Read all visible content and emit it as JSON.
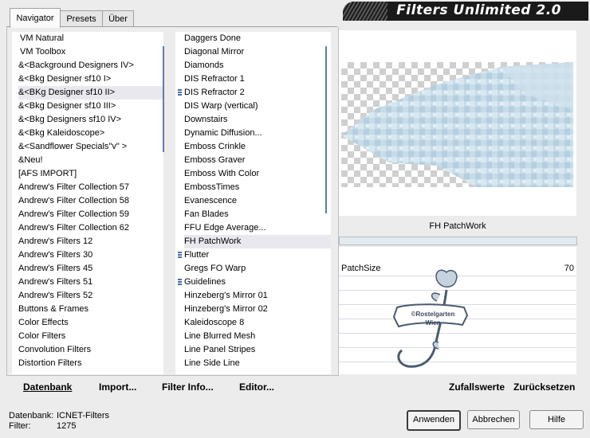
{
  "tabs": [
    "Navigator",
    "Presets",
    "Über"
  ],
  "banner": "Filters Unlimited 2.0",
  "categories": [
    "VM Natural",
    "VM Toolbox",
    "&<Background Designers IV>",
    "&<Bkg Designer sf10 I>",
    "&<BKg Designer sf10 II>",
    "&<Bkg Designer sf10 III>",
    "&<Bkg Designers sf10 IV>",
    "&<Bkg Kaleidoscope>",
    "&<Sandflower Specials\"v\" >",
    "&Neu!",
    "[AFS IMPORT]",
    "Andrew's Filter Collection 57",
    "Andrew's Filter Collection 58",
    "Andrew's Filter Collection 59",
    "Andrew's Filter Collection 62",
    "Andrew's Filters 12",
    "Andrew's Filters 30",
    "Andrew's Filters 45",
    "Andrew's Filters 51",
    "Andrew's Filters 52",
    "Buttons & Frames",
    "Color Effects",
    "Color Filters",
    "Convolution Filters",
    "Distortion Filters"
  ],
  "filters": [
    "Daggers Done",
    "Diagonal Mirror",
    "Diamonds",
    "DIS Refractor 1",
    "DIS Refractor 2",
    "DIS Warp (vertical)",
    "Downstairs",
    "Dynamic Diffusion...",
    "Emboss Crinkle",
    "Emboss Graver",
    "Emboss With Color",
    "EmbossTimes",
    "Evanescence",
    "Fan Blades",
    "FFU Edge Average...",
    "FH PatchWork",
    "Flutter",
    "Gregs FO Warp",
    "Guidelines",
    "Hinzeberg's Mirror 01",
    "Hinzeberg's Mirror 02",
    "Kaleidoscope 8",
    "Line Blurred Mesh",
    "Line Panel Stripes",
    "Line Side Line"
  ],
  "selected_category": "&<BKg Designer sf10 II>",
  "selected_filter": "FH PatchWork",
  "filter_name": "FH PatchWork",
  "param": {
    "name": "PatchSize",
    "value": "70"
  },
  "watermark": {
    "line1": "©Rostelgarten",
    "line2": "Wien"
  },
  "bottom": {
    "datenbank": "Datenbank",
    "import": "Import...",
    "filterinfo": "Filter Info...",
    "editor": "Editor...",
    "random": "Zufallswerte",
    "reset": "Zurücksetzen"
  },
  "status": {
    "db_label": "Datenbank:",
    "db_value": "ICNET-Filters",
    "filter_label": "Filter:",
    "filter_count": "1275"
  },
  "buttons": {
    "apply": "Anwenden",
    "cancel": "Abbrechen",
    "help": "Hilfe"
  }
}
